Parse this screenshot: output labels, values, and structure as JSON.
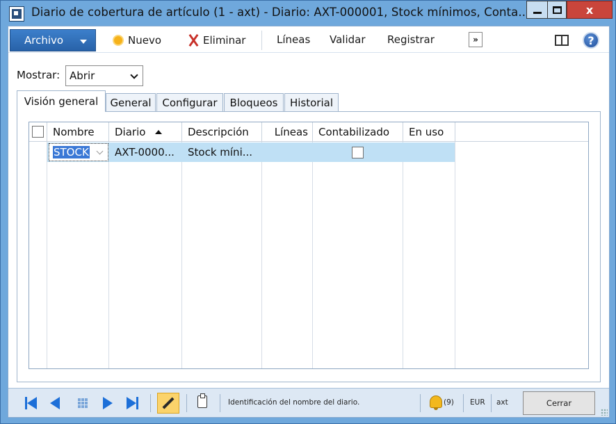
{
  "window": {
    "title": "Diario de cobertura de artículo (1 - axt) - Diario: AXT-000001, Stock mínimos, Conta...",
    "close_glyph": "x"
  },
  "actionpane": {
    "archivo": "Archivo",
    "nuevo": "Nuevo",
    "eliminar": "Eliminar",
    "lineas": "Líneas",
    "validar": "Validar",
    "registrar": "Registrar",
    "more": "»",
    "help": "?"
  },
  "filter": {
    "label": "Mostrar:",
    "value": "Abrir"
  },
  "tabs": [
    "Visión general",
    "General",
    "Configurar",
    "Bloqueos",
    "Historial"
  ],
  "grid": {
    "columns": [
      "Nombre",
      "Diario",
      "Descripción",
      "Líneas",
      "Contabilizado",
      "En uso"
    ],
    "sort_column": "Diario",
    "rows": [
      {
        "nombre": "STOCK",
        "diario": "AXT-0000...",
        "descripcion": "Stock míni...",
        "lineas": "",
        "contabilizado": false,
        "en_uso": ""
      }
    ]
  },
  "status": {
    "help_text": "Identificación del nombre del diario.",
    "notifications": "(9)",
    "currency": "EUR",
    "company": "axt",
    "close": "Cerrar"
  },
  "colors": {
    "titlebar": "#6fa8dc",
    "archivo": "#2d6bb5",
    "selected_row": "#bfe0f5",
    "nav_arrows": "#1c6fd8",
    "close_button": "#c9453b"
  }
}
